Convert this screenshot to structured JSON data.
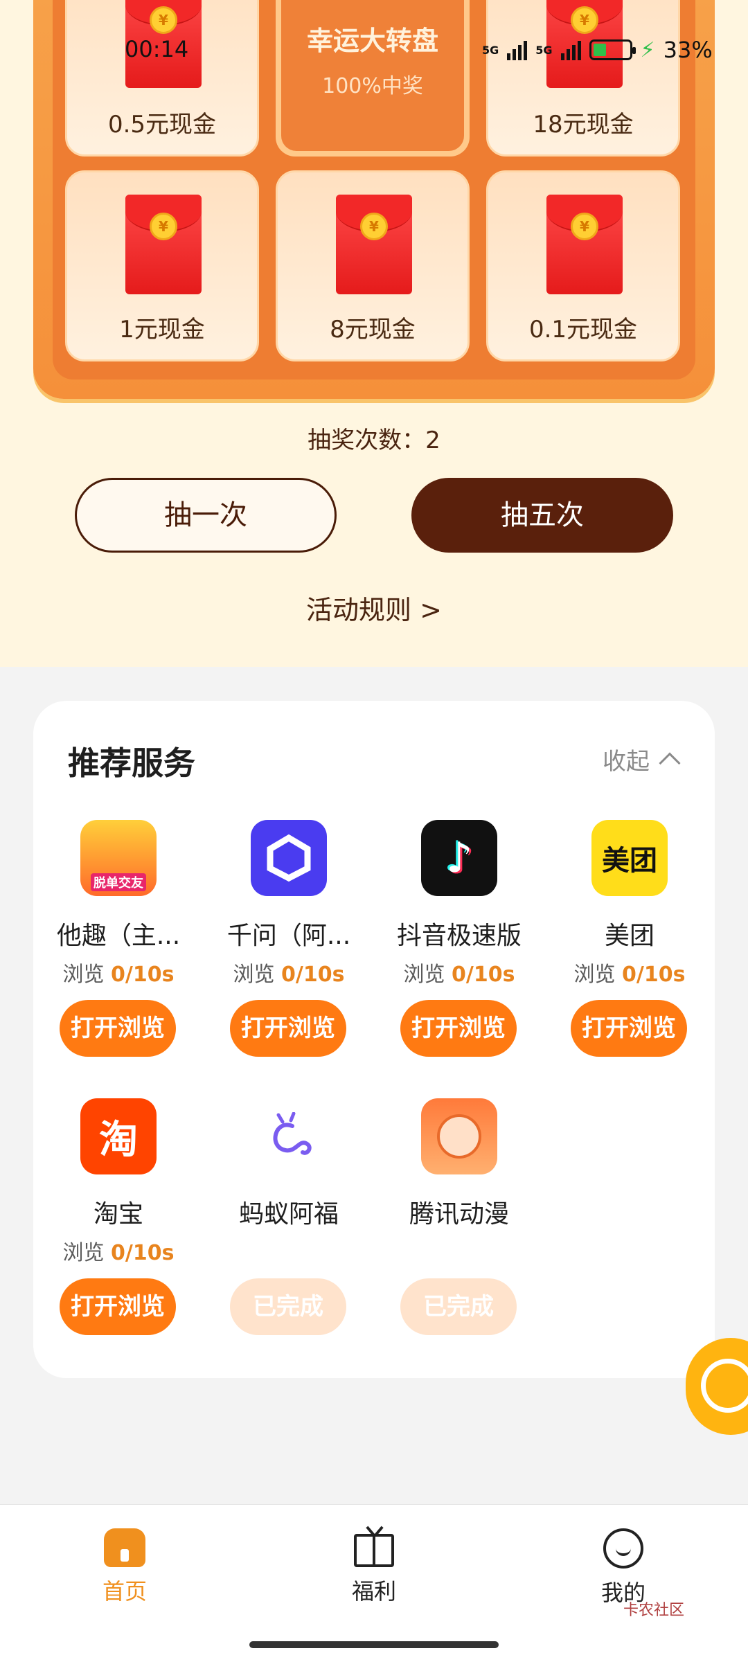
{
  "status_bar": {
    "time": "00:14",
    "network1": "5G",
    "network2": "5G",
    "battery": "33%"
  },
  "lottery": {
    "center_title": "幸运大转盘",
    "center_sub": "100%中奖",
    "prizes": [
      "0.5元现金",
      "18元现金",
      "1元现金",
      "8元现金",
      "0.1元现金"
    ],
    "coin_symbol": "¥",
    "draw_count": "抽奖次数：2",
    "draw_once": "抽一次",
    "draw_five": "抽五次",
    "rules": "活动规则 >"
  },
  "services": {
    "title": "推荐服务",
    "collapse": "收起",
    "browse_prefix": "浏览",
    "items": [
      {
        "name": "他趣（主...",
        "progress": "0/10s",
        "button": "打开浏览",
        "icon_text": "脱单交友"
      },
      {
        "name": "千问（阿...",
        "progress": "0/10s",
        "button": "打开浏览",
        "icon_text": ""
      },
      {
        "name": "抖音极速版",
        "progress": "0/10s",
        "button": "打开浏览",
        "icon_text": ""
      },
      {
        "name": "美团",
        "progress": "0/10s",
        "button": "打开浏览",
        "icon_text": "美团"
      },
      {
        "name": "淘宝",
        "progress": "0/10s",
        "button": "打开浏览",
        "icon_text": "淘"
      },
      {
        "name": "蚂蚁阿福",
        "button": "已完成",
        "icon_text": ""
      },
      {
        "name": "腾讯动漫",
        "button": "已完成",
        "icon_text": ""
      }
    ]
  },
  "nav": {
    "home": "首页",
    "welfare": "福利",
    "mine": "我的"
  },
  "watermark": "卡农社区",
  "colors": {
    "accent": "#ff7a12",
    "dark_brown": "#5a200c",
    "board": "#ee7d32"
  }
}
